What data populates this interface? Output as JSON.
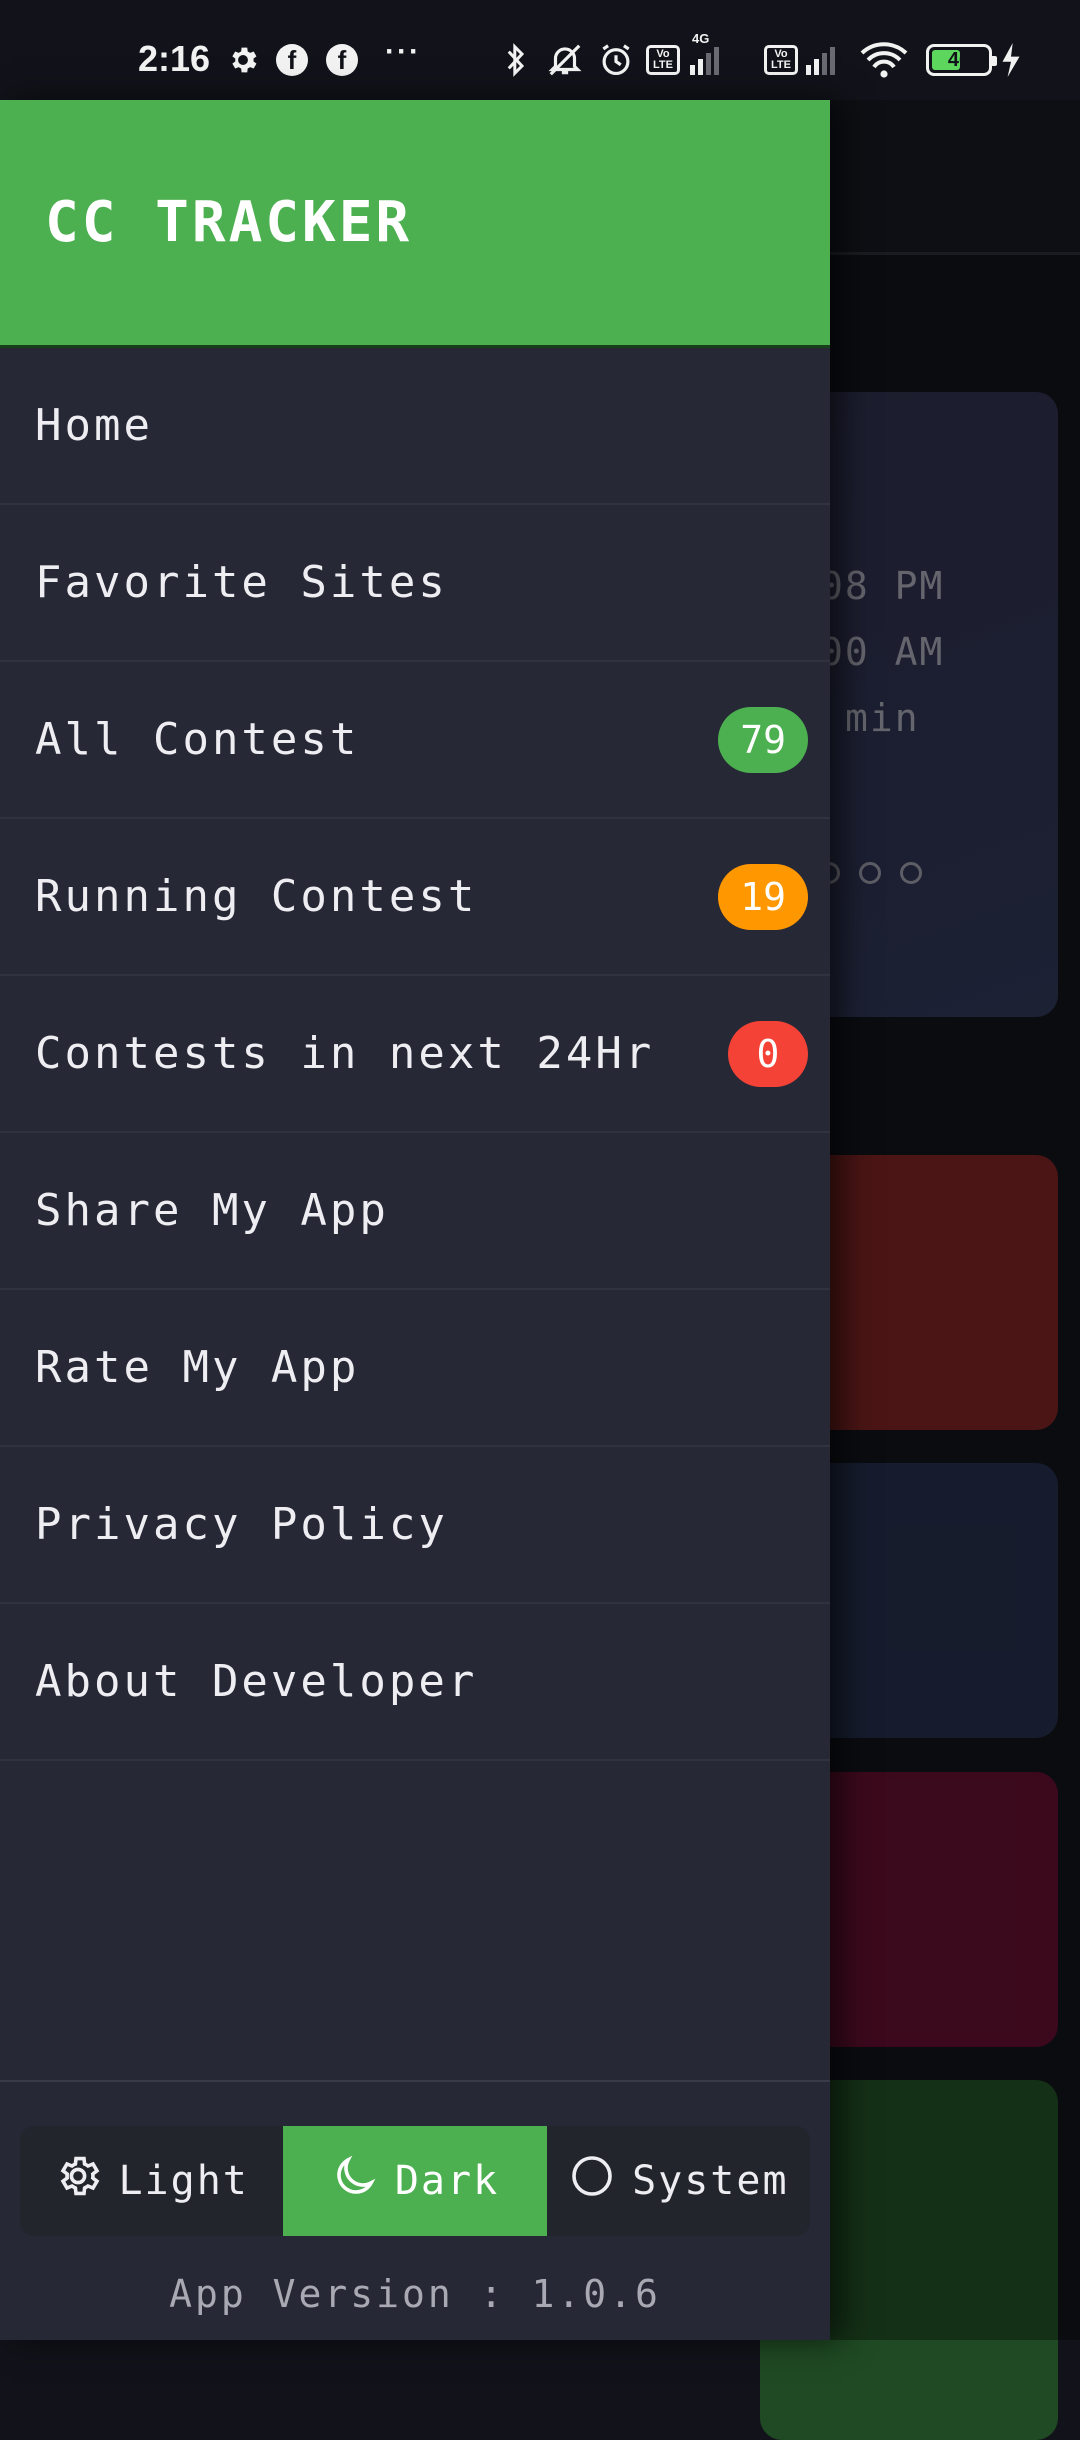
{
  "status_bar": {
    "time": "2:16",
    "more_glyph": "···",
    "lte_label_top": "Vo",
    "lte_label_bottom": "LTE",
    "network_label": "4G",
    "battery": "46"
  },
  "background_screen": {
    "lines": [
      "08 PM",
      "00 AM",
      "min"
    ]
  },
  "drawer": {
    "title": "CC TRACKER",
    "items": [
      {
        "label": "Home"
      },
      {
        "label": "Favorite Sites"
      },
      {
        "label": "All Contest",
        "badge": "79",
        "badge_color": "#4caf50"
      },
      {
        "label": "Running Contest",
        "badge": "19",
        "badge_color": "#ff9800"
      },
      {
        "label": "Contests in next 24Hr",
        "badge": "0",
        "badge_color": "#f44336"
      },
      {
        "label": "Share My App"
      },
      {
        "label": "Rate My App"
      },
      {
        "label": "Privacy Policy"
      },
      {
        "label": "About Developer"
      }
    ],
    "theme": {
      "options": [
        "Light",
        "Dark",
        "System"
      ],
      "selected": "Dark"
    },
    "version": "App Version : 1.0.6"
  },
  "colors": {
    "accent": "#4caf50",
    "drawer_bg": "#272836"
  }
}
